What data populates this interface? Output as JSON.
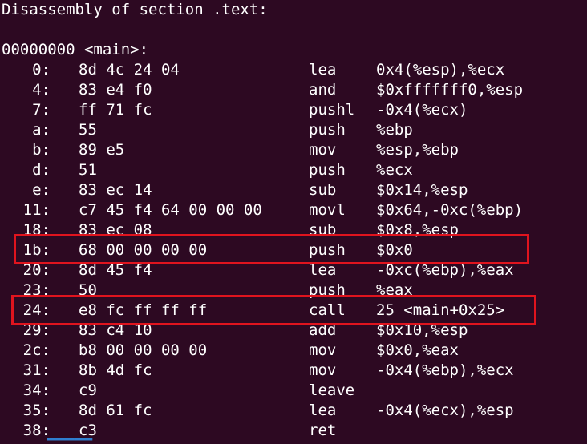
{
  "header": "Disassembly of section .text:",
  "symbol_line": "00000000 <main>:",
  "rows": [
    {
      "addr": "0:",
      "bytes": "8d 4c 24 04",
      "mnemonic": "lea",
      "operands": "0x4(%esp),%ecx"
    },
    {
      "addr": "4:",
      "bytes": "83 e4 f0",
      "mnemonic": "and",
      "operands": "$0xfffffff0,%esp"
    },
    {
      "addr": "7:",
      "bytes": "ff 71 fc",
      "mnemonic": "pushl",
      "operands": "-0x4(%ecx)"
    },
    {
      "addr": "a:",
      "bytes": "55",
      "mnemonic": "push",
      "operands": "%ebp"
    },
    {
      "addr": "b:",
      "bytes": "89 e5",
      "mnemonic": "mov",
      "operands": "%esp,%ebp"
    },
    {
      "addr": "d:",
      "bytes": "51",
      "mnemonic": "push",
      "operands": "%ecx"
    },
    {
      "addr": "e:",
      "bytes": "83 ec 14",
      "mnemonic": "sub",
      "operands": "$0x14,%esp"
    },
    {
      "addr": "11:",
      "bytes": "c7 45 f4 64 00 00 00",
      "mnemonic": "movl",
      "operands": "$0x64,-0xc(%ebp)"
    },
    {
      "addr": "18:",
      "bytes": "83 ec 08",
      "mnemonic": "sub",
      "operands": "$0x8,%esp"
    },
    {
      "addr": "1b:",
      "bytes": "68 00 00 00 00",
      "mnemonic": "push",
      "operands": "$0x0"
    },
    {
      "addr": "20:",
      "bytes": "8d 45 f4",
      "mnemonic": "lea",
      "operands": "-0xc(%ebp),%eax"
    },
    {
      "addr": "23:",
      "bytes": "50",
      "mnemonic": "push",
      "operands": "%eax"
    },
    {
      "addr": "24:",
      "bytes": "e8 fc ff ff ff",
      "mnemonic": "call",
      "operands": "25 <main+0x25>"
    },
    {
      "addr": "29:",
      "bytes": "83 c4 10",
      "mnemonic": "add",
      "operands": "$0x10,%esp"
    },
    {
      "addr": "2c:",
      "bytes": "b8 00 00 00 00",
      "mnemonic": "mov",
      "operands": "$0x0,%eax"
    },
    {
      "addr": "31:",
      "bytes": "8b 4d fc",
      "mnemonic": "mov",
      "operands": "-0x4(%ebp),%ecx"
    },
    {
      "addr": "34:",
      "bytes": "c9",
      "mnemonic": "leave",
      "operands": ""
    },
    {
      "addr": "35:",
      "bytes": "8d 61 fc",
      "mnemonic": "lea",
      "operands": "-0x4(%ecx),%esp"
    },
    {
      "addr": "38:",
      "bytes": "c3",
      "mnemonic": "ret",
      "operands": ""
    }
  ],
  "colors": {
    "background": "#2d0922",
    "text": "#ffffff",
    "highlight": "#e0141e"
  }
}
